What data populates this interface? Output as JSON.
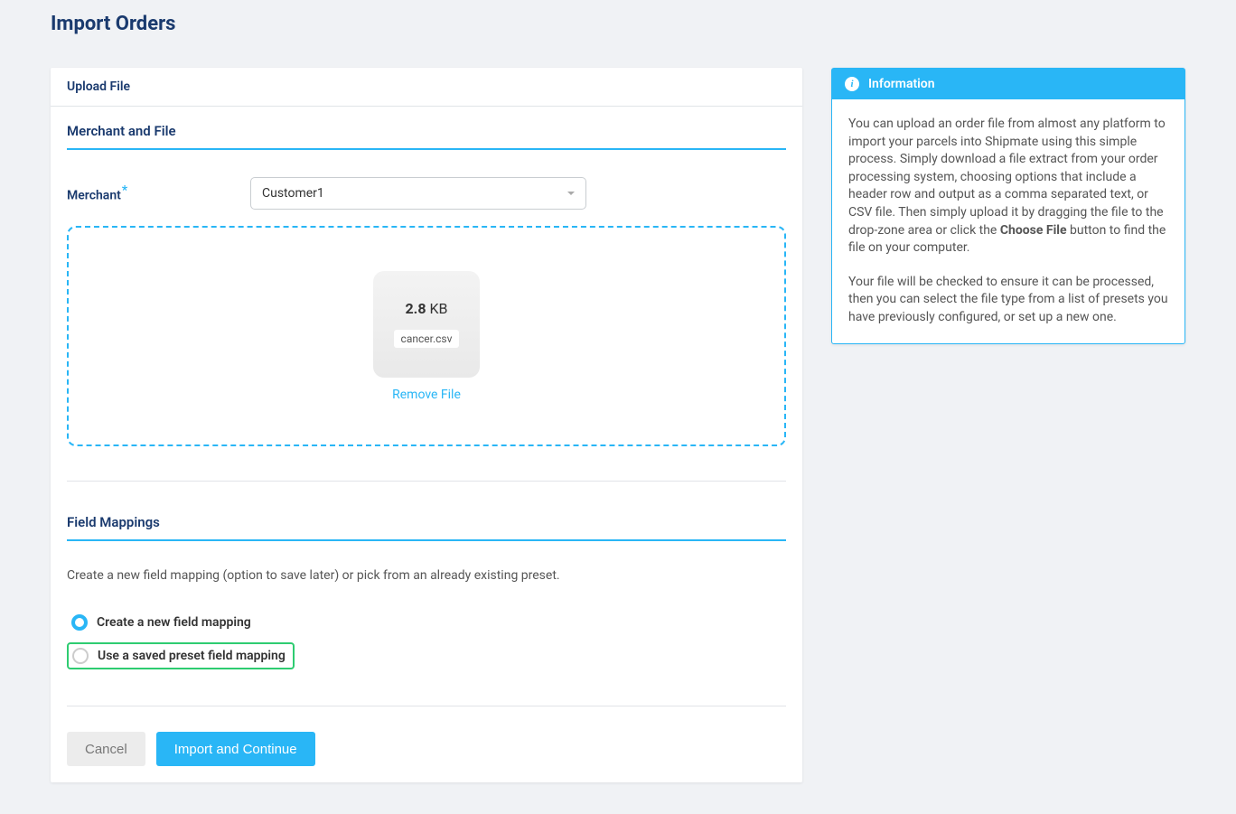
{
  "page": {
    "title": "Import Orders"
  },
  "tabs": {
    "upload": "Upload File"
  },
  "sections": {
    "merchant": "Merchant and File",
    "mappings": "Field Mappings"
  },
  "form": {
    "merchant_label": "Merchant",
    "merchant_value": "Customer1"
  },
  "file": {
    "size_value": "2.8",
    "size_unit": "KB",
    "name": "cancer.csv",
    "remove_label": "Remove File"
  },
  "mappings": {
    "description": "Create a new field mapping (option to save later) or pick from an already existing preset.",
    "option_new": "Create a new field mapping",
    "option_saved": "Use a saved preset field mapping"
  },
  "buttons": {
    "cancel": "Cancel",
    "continue": "Import and Continue"
  },
  "info": {
    "title": "Information",
    "p1_before": "You can upload an order file from almost any platform to import your parcels into Shipmate using this simple process. Simply download a file extract from your order processing system, choosing options that include a header row and output as a comma separated text, or CSV file. Then simply upload it by dragging the file to the drop-zone area or click the ",
    "p1_bold": "Choose File",
    "p1_after": " button to find the file on your computer.",
    "p2": "Your file will be checked to ensure it can be processed, then you can select the file type from a list of presets you have previously configured, or set up a new one."
  }
}
